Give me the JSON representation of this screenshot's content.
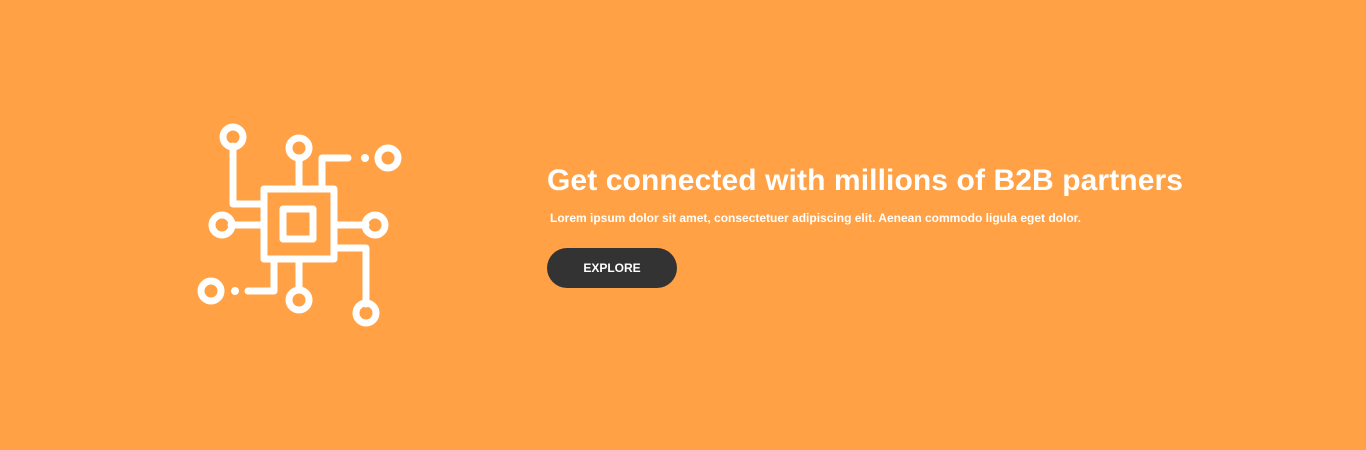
{
  "hero": {
    "background_color": "#FFA144",
    "icon": "circuit-chip-icon",
    "headline": "Get connected with millions of B2B partners",
    "subtext": "Lorem ipsum dolor sit amet, consectetuer adipiscing elit. Aenean commodo ligula eget dolor.",
    "button_label": "EXPLORE",
    "button_color": "#333333"
  }
}
